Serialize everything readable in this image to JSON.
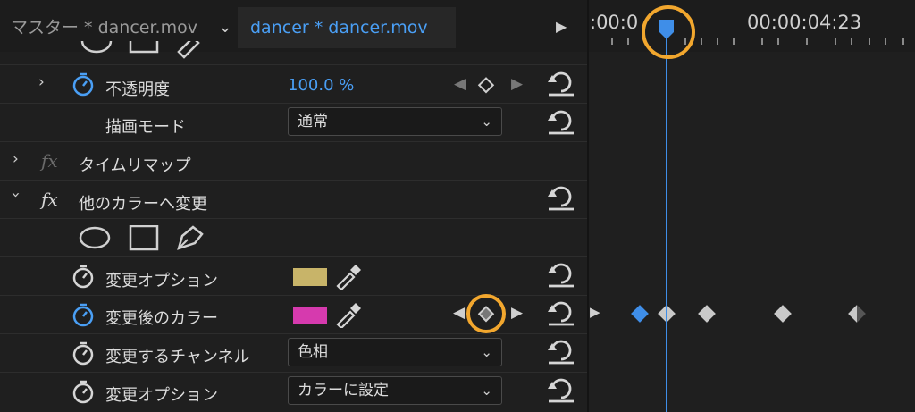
{
  "tabs": {
    "master": "マスター * dancer.mov",
    "active": "dancer * dancer.mov"
  },
  "timeline": {
    "timecode_left": ":00:0",
    "timecode_right": "00:00:04:23",
    "playhead_color": "#3f8ee8",
    "highlight_color": "#f2a72e"
  },
  "rows": {
    "opacity": {
      "label": "不透明度",
      "value": "100.0 %"
    },
    "blend": {
      "label": "描画モード",
      "value": "通常"
    },
    "timeremap": {
      "label": "タイムリマップ",
      "fx": "fx"
    },
    "changecolor": {
      "label": "他のカラーへ変更",
      "fx": "fx"
    },
    "opt1": {
      "label": "変更オプション",
      "color": "#c8b469"
    },
    "after": {
      "label": "変更後のカラー",
      "color": "#d63aae"
    },
    "channel": {
      "label": "変更するチャンネル",
      "value": "色相"
    },
    "opt2": {
      "label": "変更オプション",
      "value": "カラーに設定"
    }
  },
  "keyframes": {
    "selected_color": "#3f8ee8",
    "normal_color": "#c9c9c9"
  }
}
